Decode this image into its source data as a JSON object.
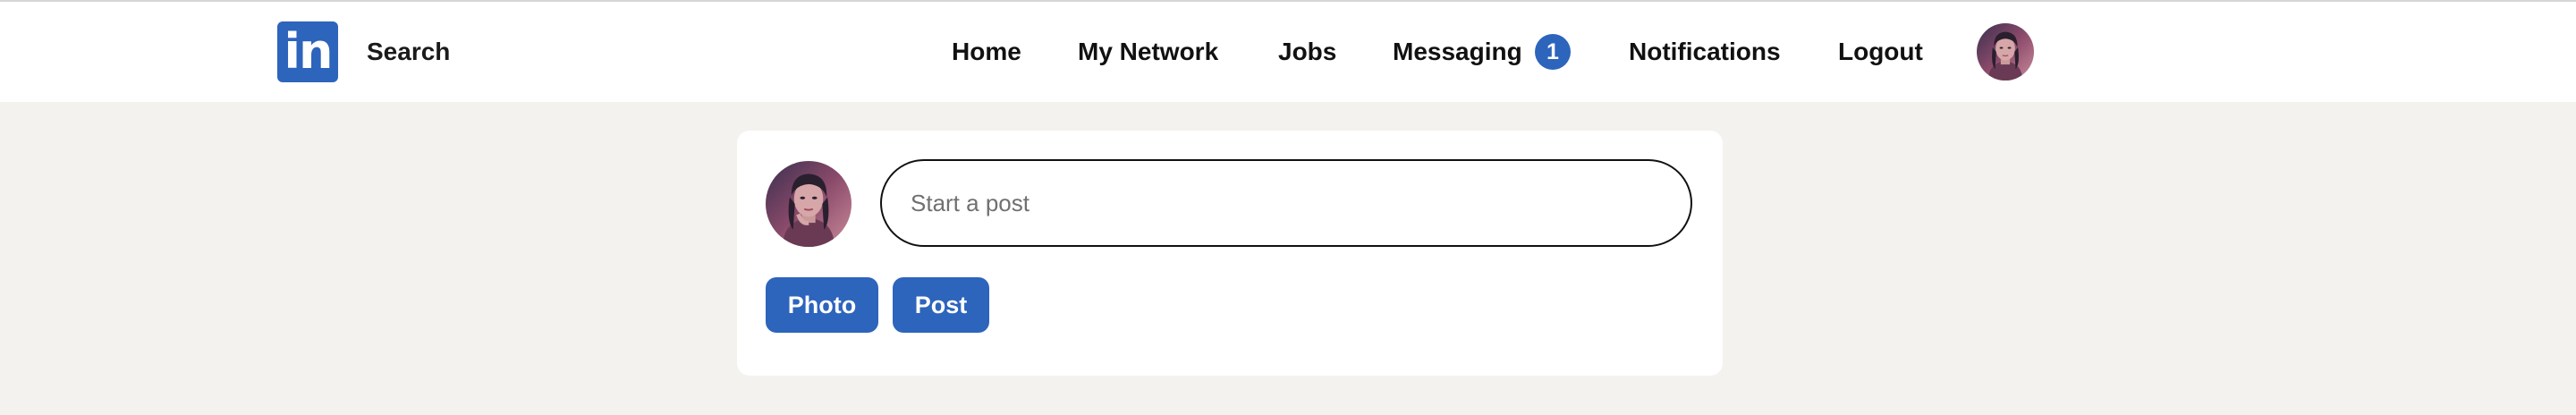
{
  "brand": {
    "logo_text": "in",
    "accent_color": "#2d64bc",
    "logo_icon": "linkedin-icon"
  },
  "navbar": {
    "search_label": "Search",
    "items": [
      {
        "label": "Home"
      },
      {
        "label": "My Network"
      },
      {
        "label": "Jobs"
      },
      {
        "label": "Messaging",
        "badge": "1"
      },
      {
        "label": "Notifications"
      },
      {
        "label": "Logout"
      }
    ],
    "avatar_icon": "user-avatar-icon"
  },
  "composer": {
    "placeholder": "Start a post",
    "value": "",
    "photo_button": "Photo",
    "post_button": "Post",
    "avatar_icon": "user-avatar-icon"
  },
  "colors": {
    "page_background": "#f3f2ef",
    "card_background": "#ffffff",
    "badge_background": "#2d64bc"
  }
}
